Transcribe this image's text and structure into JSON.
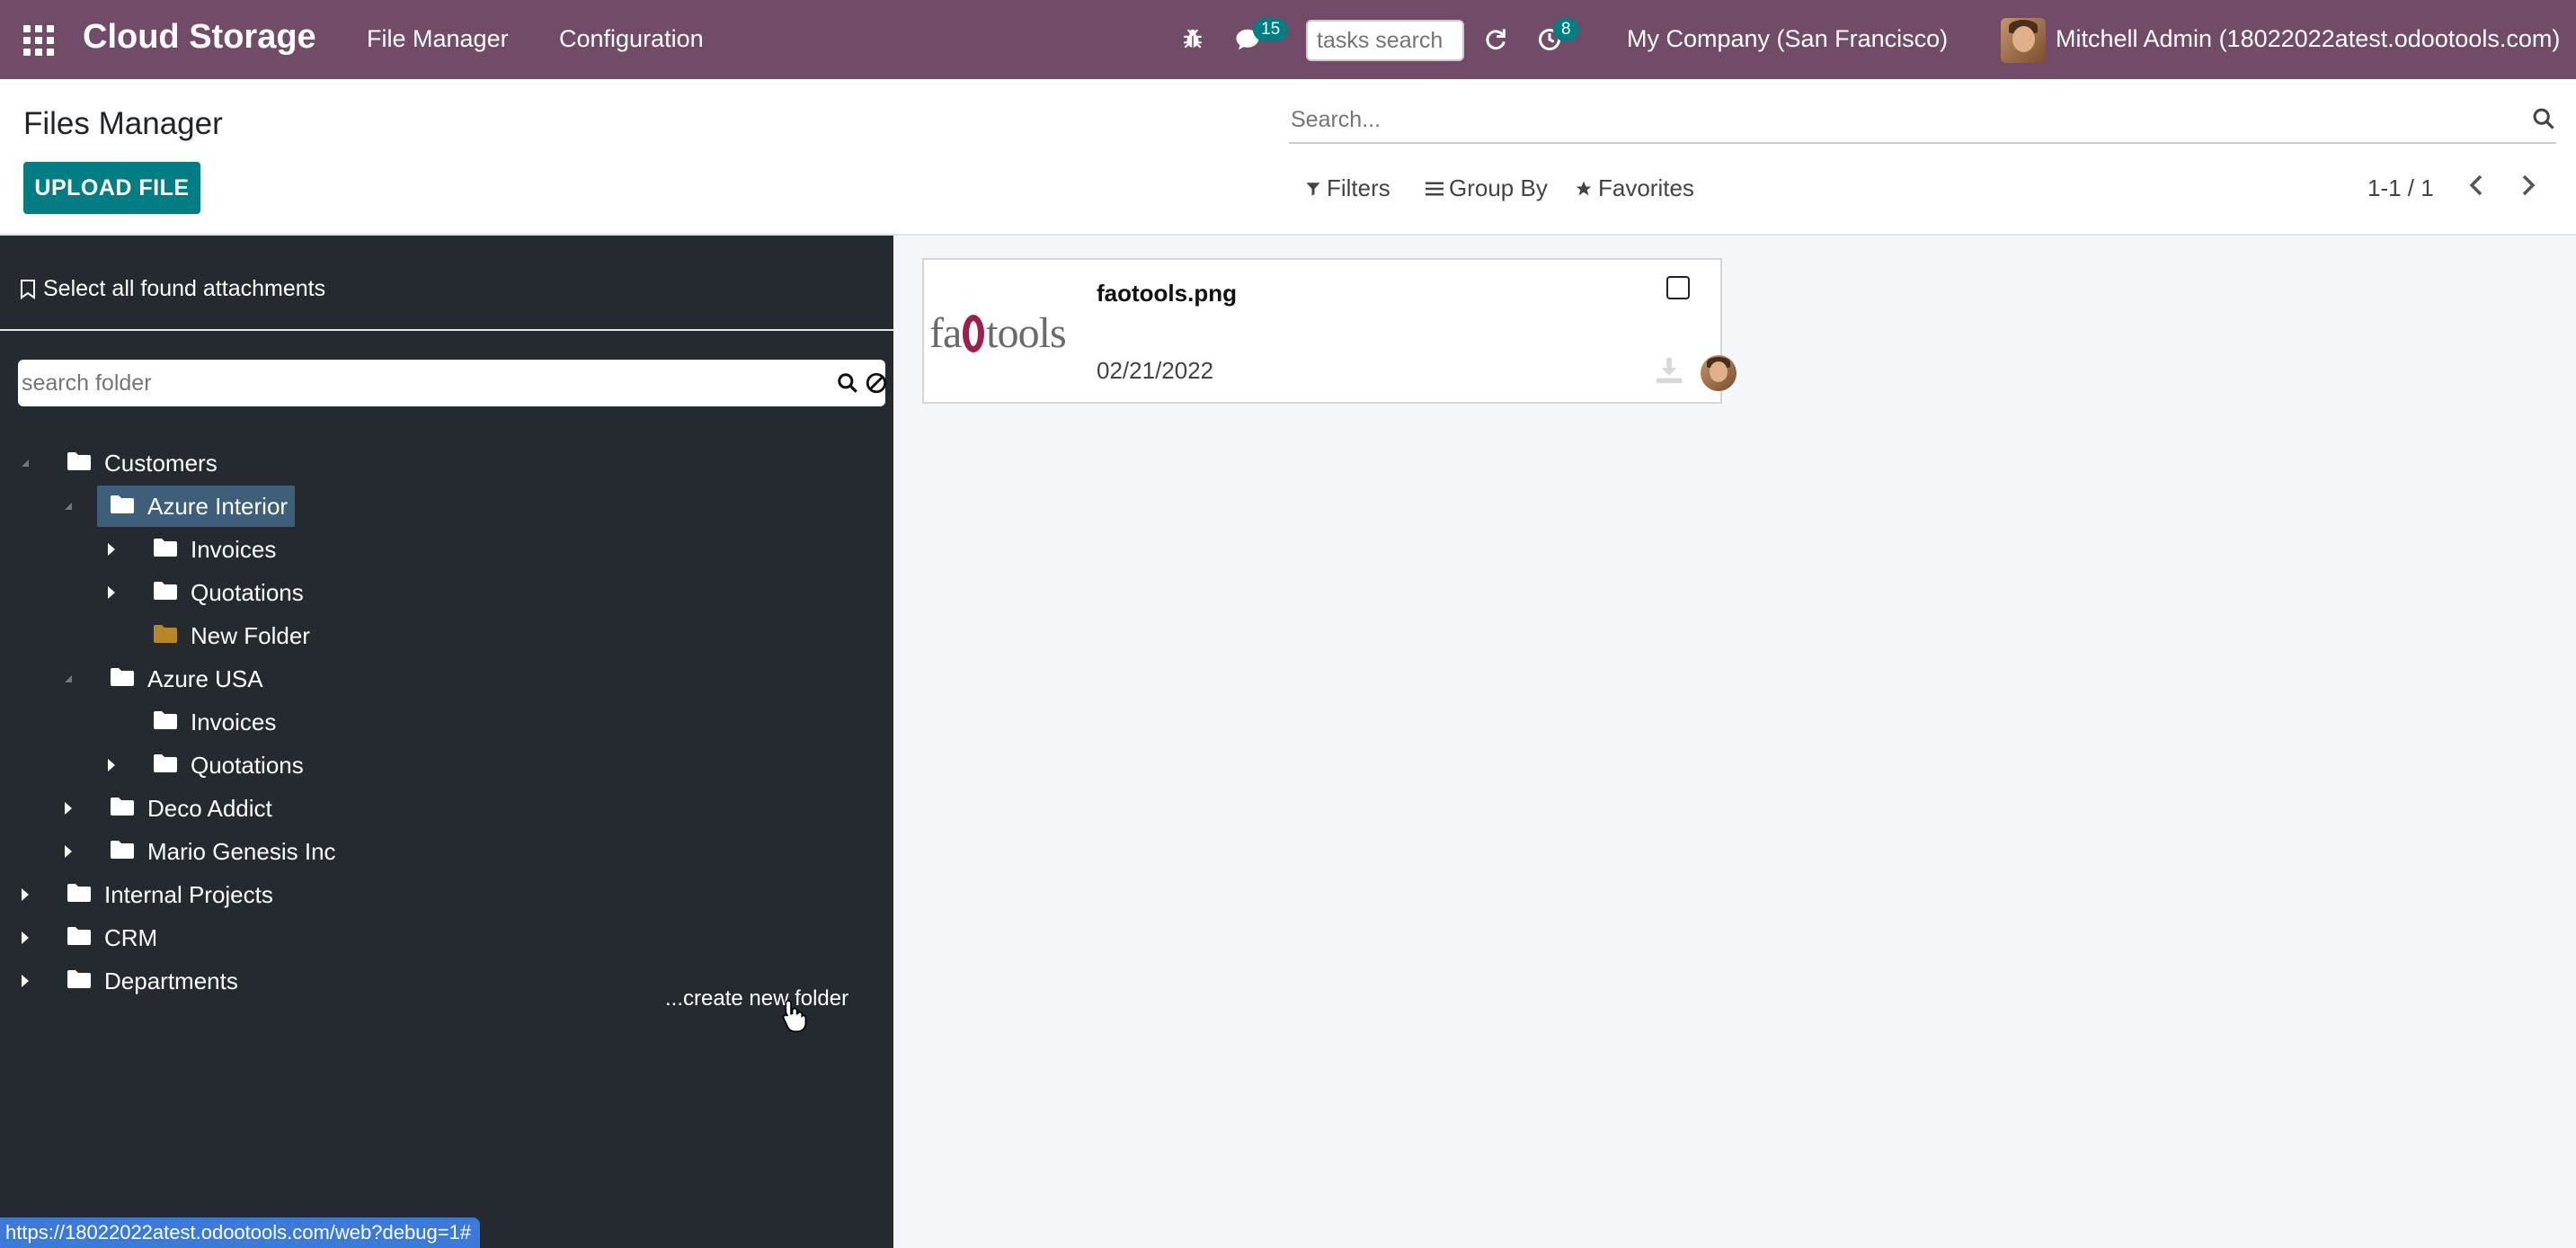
{
  "navbar": {
    "app_title": "Cloud Storage",
    "menu": [
      "File Manager",
      "Configuration"
    ],
    "messages_count": "15",
    "activities_count": "8",
    "tasks_search_placeholder": "tasks search",
    "company": "My Company (San Francisco)",
    "user": "Mitchell Admin (18022022atest.odootools.com)",
    "brand_color": "#714b67"
  },
  "control_panel": {
    "title": "Files Manager",
    "upload_label": "UPLOAD FILE",
    "search_placeholder": "Search...",
    "filters_label": "Filters",
    "group_by_label": "Group By",
    "favorites_label": "Favorites",
    "pager": "1-1 / 1"
  },
  "sidebar": {
    "select_all_label": "Select all found attachments",
    "folder_search_placeholder": "search folder",
    "create_folder_label": "...create new folder",
    "tree": [
      {
        "label": "Customers",
        "state": "open"
      },
      {
        "label": "Azure Interior",
        "state": "open",
        "selected": true
      },
      {
        "label": "Invoices",
        "state": "closed"
      },
      {
        "label": "Quotations",
        "state": "closed"
      },
      {
        "label": "New Folder",
        "state": "leaf"
      },
      {
        "label": "Azure USA",
        "state": "open"
      },
      {
        "label": "Invoices",
        "state": "leaf"
      },
      {
        "label": "Quotations",
        "state": "closed"
      },
      {
        "label": "Deco Addict",
        "state": "closed"
      },
      {
        "label": "Mario Genesis Inc",
        "state": "closed"
      },
      {
        "label": "Internal Projects",
        "state": "closed"
      },
      {
        "label": "CRM",
        "state": "closed"
      },
      {
        "label": "Departments",
        "state": "closed"
      }
    ]
  },
  "attachments": [
    {
      "name": "faotools.png",
      "date": "02/21/2022",
      "thumb_text_a": "fa",
      "thumb_text_b": "tools"
    }
  ],
  "status_bar": "https://18022022atest.odootools.com/web?debug=1#"
}
